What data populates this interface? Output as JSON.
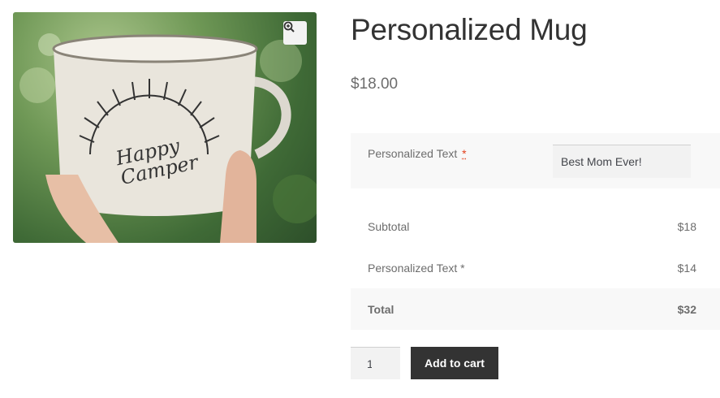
{
  "product": {
    "title": "Personalized Mug",
    "price": "$18.00",
    "image_caption_line1": "Happy",
    "image_caption_line2": "Camper"
  },
  "option": {
    "label": "Personalized Text",
    "required_mark": "*",
    "value": "Best Mom Ever!"
  },
  "totals": [
    {
      "label": "Subtotal",
      "value": "$18"
    },
    {
      "label": "Personalized Text *",
      "value": "$14"
    },
    {
      "label": "Total",
      "value": "$32"
    }
  ],
  "cart": {
    "quantity": "1",
    "add_label": "Add to cart"
  },
  "icons": {
    "zoom": "zoom-in-icon"
  }
}
